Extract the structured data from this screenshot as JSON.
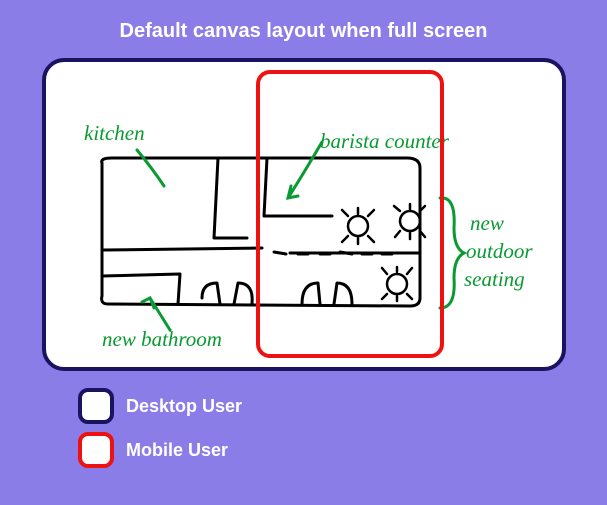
{
  "title": "Default canvas layout when full screen",
  "legend": {
    "desktop": "Desktop User",
    "mobile": "Mobile User"
  },
  "annotations": {
    "kitchen": "kitchen",
    "barista_counter": "barista counter",
    "new_outdoor_seating_line1": "new",
    "new_outdoor_seating_line2": "outdoor",
    "new_outdoor_seating_line3": "seating",
    "new_bathroom": "new bathroom"
  },
  "colors": {
    "bg": "#8b7de8",
    "desktop_stroke": "#1a1460",
    "mobile_stroke": "#e11",
    "ink_black": "#000",
    "ink_green": "#0a9a32"
  }
}
